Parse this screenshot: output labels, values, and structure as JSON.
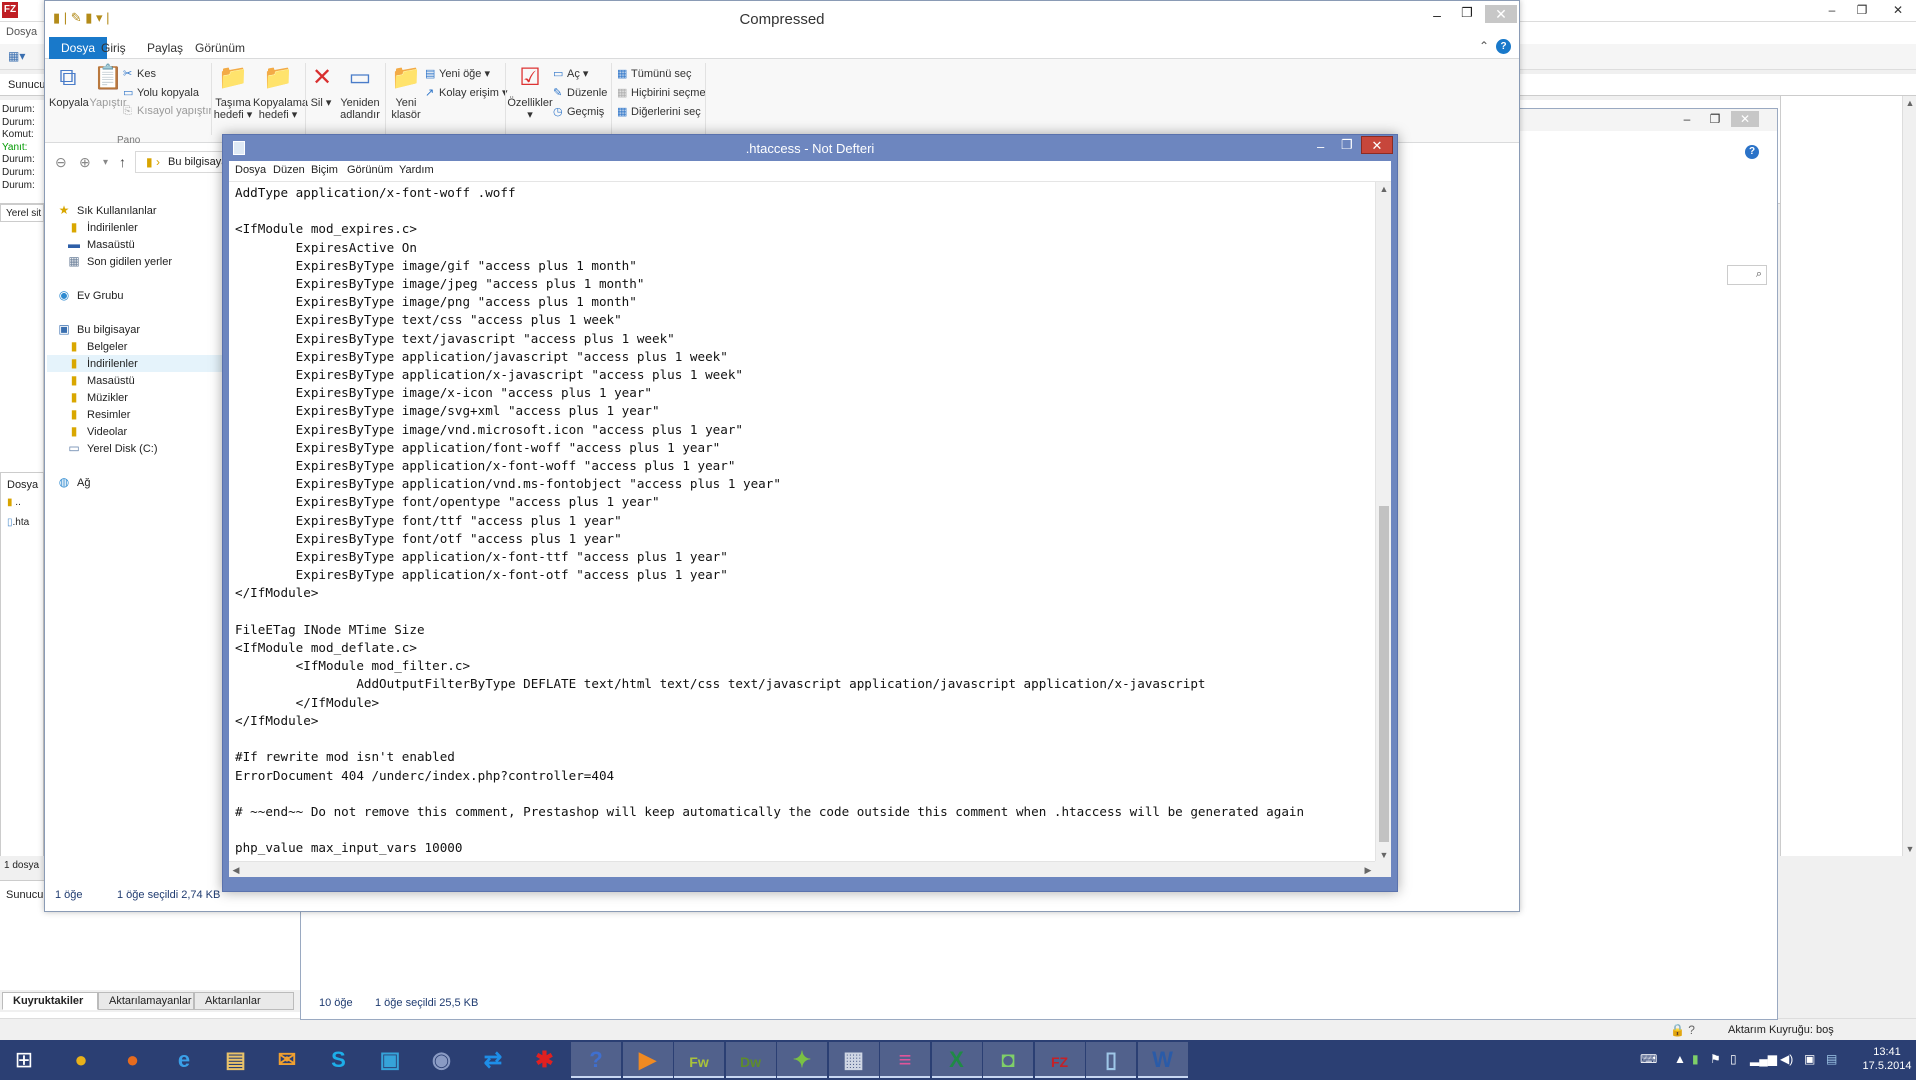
{
  "filezilla": {
    "menu_first": "Dosya",
    "quickconnect_label": "Sunucu",
    "log": [
      {
        "label": "Durum:",
        "type": "status"
      },
      {
        "label": "Durum:",
        "type": "status"
      },
      {
        "label": "Komut:",
        "type": "status"
      },
      {
        "label": "Yanıt:",
        "type": "response"
      },
      {
        "label": "Durum:",
        "type": "status"
      },
      {
        "label": "Durum:",
        "type": "status"
      },
      {
        "label": "Durum:",
        "type": "status"
      }
    ],
    "local_site_label": "Yerel sit",
    "local_files_header": "Dosya",
    "local_files": [
      "..",
      ".hta"
    ],
    "local_status": "1 dosya",
    "queue_label": "Sunucu",
    "queue_tabs": [
      "Kuyruktakiler",
      "Aktarılamayanlar",
      "Aktarılanlar"
    ],
    "queue_status": "Aktarım Kuyruğu: boş"
  },
  "explorer2": {
    "status_count": "10 öğe",
    "status_selected": "1 öğe seçildi  25,5 KB"
  },
  "explorer": {
    "title": "Compressed",
    "tabs": [
      "Dosya",
      "Giriş",
      "Paylaş",
      "Görünüm"
    ],
    "ribbon": {
      "copy": "Kopyala",
      "paste": "Yapıştır",
      "cut": "Kes",
      "copy_path": "Yolu kopyala",
      "paste_shortcut": "Kısayol yapıştır",
      "group_clipboard": "Pano",
      "move_to": "Taşıma hedefi",
      "copy_to": "Kopyalama hedefi",
      "delete": "Sil",
      "rename": "Yeniden adlandır",
      "new_folder": "Yeni klasör",
      "new_item": "Yeni öğe",
      "easy_access": "Kolay erişim",
      "properties": "Özellikler",
      "open": "Aç",
      "edit": "Düzenle",
      "history": "Geçmiş",
      "select_all": "Tümünü seç",
      "select_none": "Hiçbirini seçme",
      "invert_selection": "Diğerlerini seç"
    },
    "address": "Bu bilgisayar",
    "nav": [
      {
        "label": "Sık Kullanılanlar",
        "icon": "star-icon"
      },
      {
        "label": "İndirilenler",
        "icon": "folder-icon"
      },
      {
        "label": "Masaüstü",
        "icon": "desktop-icon"
      },
      {
        "label": "Son gidilen yerler",
        "icon": "recent-icon"
      },
      {
        "label": "Ev Grubu",
        "icon": "homegroup-icon"
      },
      {
        "label": "Bu bilgisayar",
        "icon": "computer-icon"
      },
      {
        "label": "Belgeler",
        "icon": "folder-icon"
      },
      {
        "label": "İndirilenler",
        "icon": "folder-icon"
      },
      {
        "label": "Masaüstü",
        "icon": "folder-icon"
      },
      {
        "label": "Müzikler",
        "icon": "folder-icon"
      },
      {
        "label": "Resimler",
        "icon": "folder-icon"
      },
      {
        "label": "Videolar",
        "icon": "folder-icon"
      },
      {
        "label": "Yerel Disk (C:)",
        "icon": "drive-icon"
      },
      {
        "label": "Ağ",
        "icon": "network-icon"
      }
    ],
    "status_count": "1 öğe",
    "status_selected": "1 öğe seçildi  2,74 KB"
  },
  "notepad": {
    "title": ".htaccess - Not Defteri",
    "menu": [
      "Dosya",
      "Düzen",
      "Biçim",
      "Görünüm",
      "Yardım"
    ],
    "lines": [
      "AddType application/x-font-woff .woff",
      "",
      "<IfModule mod_expires.c>",
      "        ExpiresActive On",
      "        ExpiresByType image/gif \"access plus 1 month\"",
      "        ExpiresByType image/jpeg \"access plus 1 month\"",
      "        ExpiresByType image/png \"access plus 1 month\"",
      "        ExpiresByType text/css \"access plus 1 week\"",
      "        ExpiresByType text/javascript \"access plus 1 week\"",
      "        ExpiresByType application/javascript \"access plus 1 week\"",
      "        ExpiresByType application/x-javascript \"access plus 1 week\"",
      "        ExpiresByType image/x-icon \"access plus 1 year\"",
      "        ExpiresByType image/svg+xml \"access plus 1 year\"",
      "        ExpiresByType image/vnd.microsoft.icon \"access plus 1 year\"",
      "        ExpiresByType application/font-woff \"access plus 1 year\"",
      "        ExpiresByType application/x-font-woff \"access plus 1 year\"",
      "        ExpiresByType application/vnd.ms-fontobject \"access plus 1 year\"",
      "        ExpiresByType font/opentype \"access plus 1 year\"",
      "        ExpiresByType font/ttf \"access plus 1 year\"",
      "        ExpiresByType font/otf \"access plus 1 year\"",
      "        ExpiresByType application/x-font-ttf \"access plus 1 year\"",
      "        ExpiresByType application/x-font-otf \"access plus 1 year\"",
      "</IfModule>",
      "",
      "FileETag INode MTime Size",
      "<IfModule mod_deflate.c>",
      "        <IfModule mod_filter.c>",
      "                AddOutputFilterByType DEFLATE text/html text/css text/javascript application/javascript application/x-javascript",
      "        </IfModule>",
      "</IfModule>",
      "",
      "#If rewrite mod isn't enabled",
      "ErrorDocument 404 /underc/index.php?controller=404",
      "",
      "# ~~end~~ Do not remove this comment, Prestashop will keep automatically the code outside this comment when .htaccess will be generated again",
      "",
      "php_value max_input_vars 10000"
    ]
  },
  "taskbar": {
    "apps": [
      {
        "name": "chrome-icon",
        "glyph": "●",
        "color": "#e8b11a"
      },
      {
        "name": "firefox-icon",
        "glyph": "●",
        "color": "#e66b1e"
      },
      {
        "name": "internet-explorer-icon",
        "glyph": "e",
        "color": "#3aa0e8"
      },
      {
        "name": "file-explorer-icon",
        "glyph": "▤",
        "color": "#e8c26a"
      },
      {
        "name": "outlook-icon",
        "glyph": "✉",
        "color": "#f0a030"
      },
      {
        "name": "skype-icon",
        "glyph": "S",
        "color": "#1daee9"
      },
      {
        "name": "app-blue-icon",
        "glyph": "▣",
        "color": "#36a3d9"
      },
      {
        "name": "globe-app-icon",
        "glyph": "◉",
        "color": "#8a9bc4"
      },
      {
        "name": "teamviewer-icon",
        "glyph": "⇄",
        "color": "#1e8ee8"
      },
      {
        "name": "paint-splash-icon",
        "glyph": "✱",
        "color": "#e02020"
      },
      {
        "name": "help-app-icon",
        "glyph": "?",
        "color": "#3f6fcf"
      },
      {
        "name": "media-player-icon",
        "glyph": "▶",
        "color": "#f08a22"
      },
      {
        "name": "fireworks-icon",
        "glyph": "Fw",
        "color": "#a9c23b"
      },
      {
        "name": "dreamweaver-icon",
        "glyph": "Dw",
        "color": "#5e8c2c"
      },
      {
        "name": "parrot-app-icon",
        "glyph": "✦",
        "color": "#7ac143"
      },
      {
        "name": "calculator-icon",
        "glyph": "▦",
        "color": "#cfd6e4"
      },
      {
        "name": "books-app-icon",
        "glyph": "≡",
        "color": "#e0559a"
      },
      {
        "name": "excel-icon",
        "glyph": "X",
        "color": "#1f8a46"
      },
      {
        "name": "robot-app-icon",
        "glyph": "◘",
        "color": "#7fd068"
      },
      {
        "name": "filezilla-icon",
        "glyph": "FZ",
        "color": "#c42127"
      },
      {
        "name": "notepad-icon",
        "glyph": "▯",
        "color": "#9fc7e8"
      },
      {
        "name": "word-icon",
        "glyph": "W",
        "color": "#2a5ba8"
      }
    ],
    "time": "13:41",
    "date": "17.5.2014"
  }
}
